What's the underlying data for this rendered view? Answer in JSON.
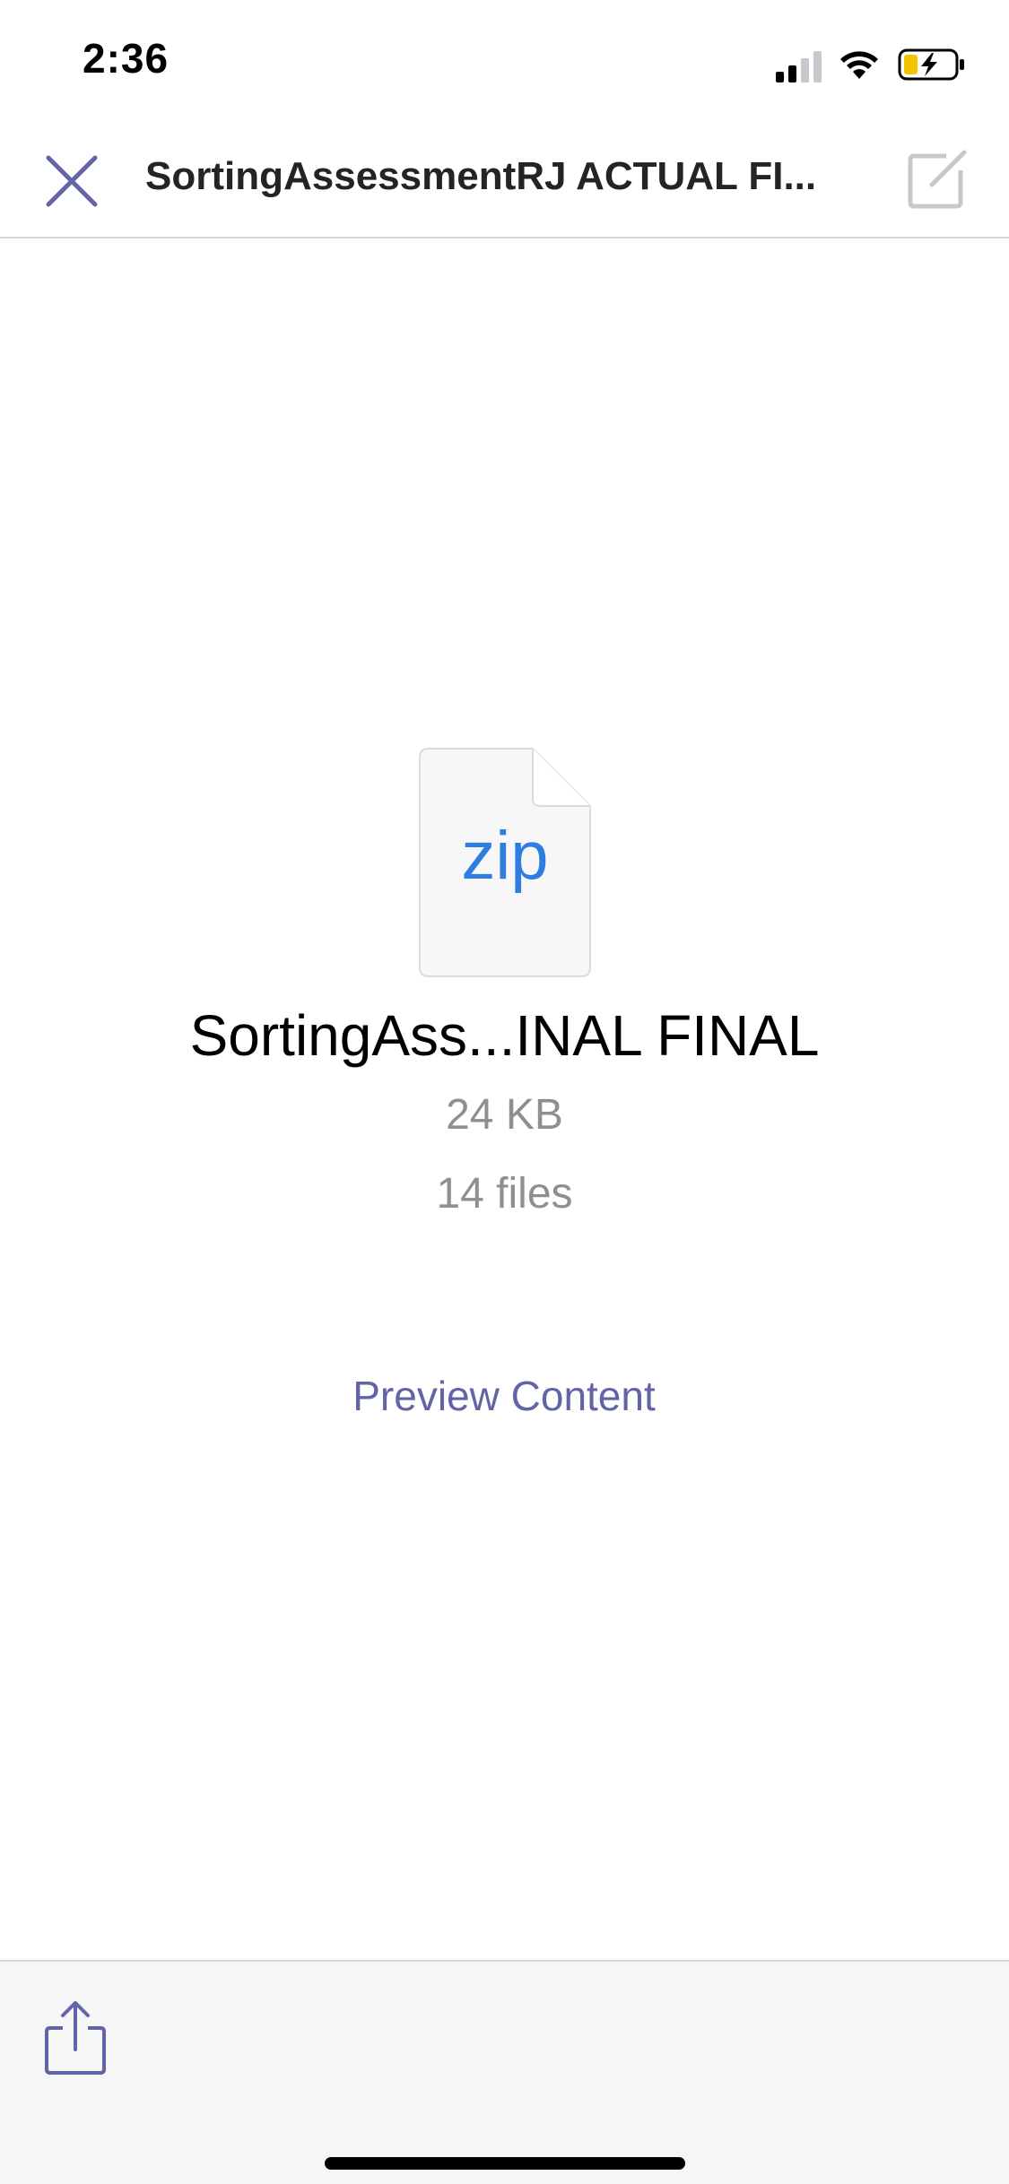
{
  "status_bar": {
    "time": "2:36",
    "icons": [
      "cellular-signal-icon",
      "wifi-icon",
      "battery-charging-icon"
    ],
    "battery_color": "#f5c400"
  },
  "nav": {
    "title": "SortingAssessmentRJ ACTUAL FI...",
    "close_icon": "close-icon",
    "edit_icon": "edit-icon",
    "accent_color": "#6264a7"
  },
  "file": {
    "extension": "zip",
    "name": "SortingAss...INAL FINAL",
    "size": "24 KB",
    "count": "14 files",
    "extension_color": "#2f7de1"
  },
  "actions": {
    "preview_label": "Preview Content"
  },
  "toolbar": {
    "share_icon": "share-icon"
  }
}
